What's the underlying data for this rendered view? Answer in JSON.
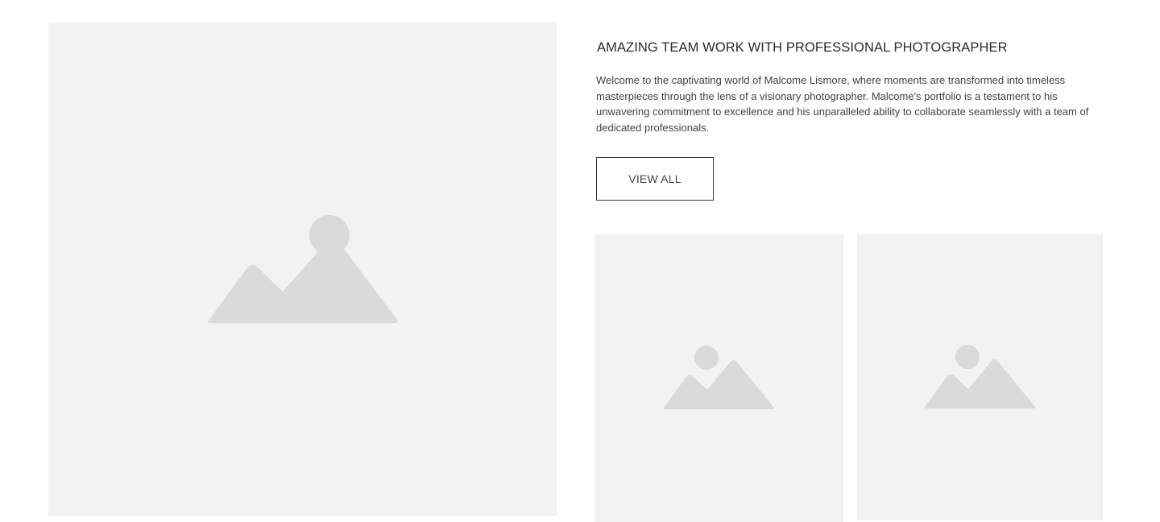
{
  "content": {
    "heading": "AMAZING TEAM WORK WITH PROFESSIONAL PHOTOGRAPHER",
    "description": "Welcome to the captivating world of Malcome Lismore, where moments are transformed into timeless masterpieces through the lens of a visionary photographer. Malcome's portfolio is a testament to his unwavering commitment to excellence and his unparalleled ability to collaborate seamlessly with a team of dedicated professionals.",
    "cta_label": "VIEW ALL"
  },
  "images": [
    {
      "icon": "image-placeholder-icon"
    },
    {
      "icon": "image-placeholder-icon"
    },
    {
      "icon": "image-placeholder-icon"
    }
  ],
  "colors": {
    "placeholder_bg": "#f2f2f4",
    "placeholder_icon": "#d9dadd",
    "text": "#2b2b30",
    "button_border": "#3a3a3e"
  }
}
